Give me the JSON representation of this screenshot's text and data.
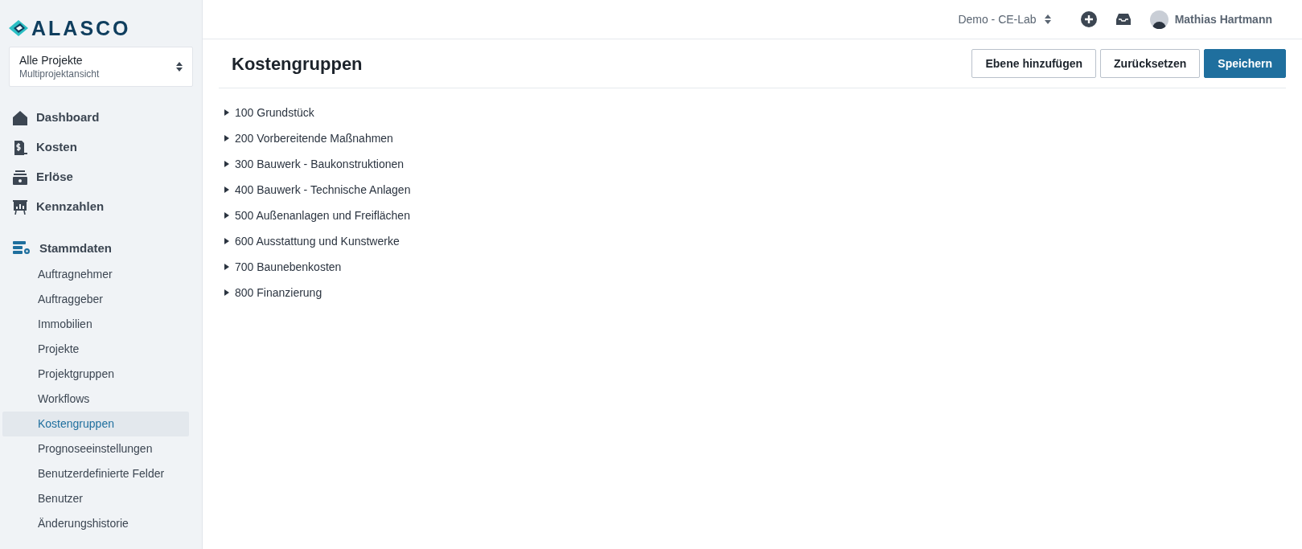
{
  "logo": {
    "text": "ALASCO"
  },
  "project_selector": {
    "title": "Alle Projekte",
    "subtitle": "Multiprojektansicht"
  },
  "nav": [
    {
      "kind": "home",
      "label": "Dashboard"
    },
    {
      "kind": "cost",
      "label": "Kosten"
    },
    {
      "kind": "revenue",
      "label": "Erlöse"
    },
    {
      "kind": "kpi",
      "label": "Kennzahlen"
    }
  ],
  "master_data": {
    "label": "Stammdaten",
    "items": [
      {
        "label": "Auftragnehmer",
        "selected": false
      },
      {
        "label": "Auftraggeber",
        "selected": false
      },
      {
        "label": "Immobilien",
        "selected": false
      },
      {
        "label": "Projekte",
        "selected": false
      },
      {
        "label": "Projektgruppen",
        "selected": false
      },
      {
        "label": "Workflows",
        "selected": false
      },
      {
        "label": "Kostengruppen",
        "selected": true
      },
      {
        "label": "Prognoseeinstellungen",
        "selected": false
      },
      {
        "label": "Benutzerdefinierte Felder",
        "selected": false
      },
      {
        "label": "Benutzer",
        "selected": false
      },
      {
        "label": "Änderungshistorie",
        "selected": false
      }
    ]
  },
  "topbar": {
    "workspace": "Demo - CE-Lab",
    "user": "Mathias Hartmann"
  },
  "page": {
    "title": "Kostengruppen",
    "buttons": [
      {
        "label": "Ebene hinzufügen",
        "kind": "secondary"
      },
      {
        "label": "Zurücksetzen",
        "kind": "secondary"
      },
      {
        "label": "Speichern",
        "kind": "primary"
      }
    ]
  },
  "tree": [
    {
      "label": "100 Grundstück",
      "expanded": false
    },
    {
      "label": "200 Vorbereitende Maßnahmen",
      "expanded": false
    },
    {
      "label": "300 Bauwerk - Baukonstruktionen",
      "expanded": false
    },
    {
      "label": "400 Bauwerk - Technische Anlagen",
      "expanded": false
    },
    {
      "label": "500 Außenanlagen und Freiflächen",
      "expanded": false
    },
    {
      "label": "600 Ausstattung und Kunstwerke",
      "expanded": false
    },
    {
      "label": "700 Baunebenkosten",
      "expanded": false
    },
    {
      "label": "800 Finanzierung",
      "expanded": false
    }
  ]
}
